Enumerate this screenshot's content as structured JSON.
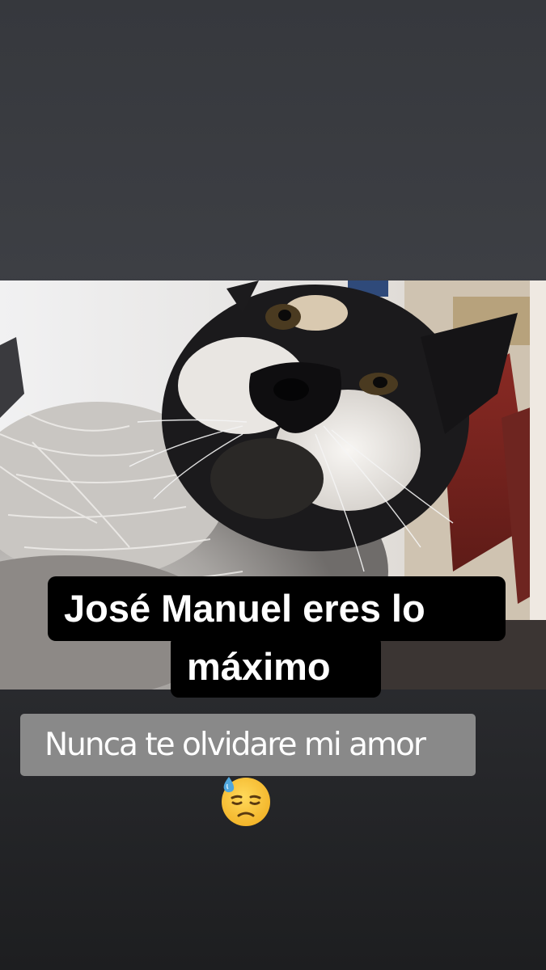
{
  "story": {
    "photo_subject": "cat-photo",
    "caption_line_1": "José Manuel eres lo",
    "caption_line_2": "máximo",
    "subtitle": "Nunca te olvidare mi amor",
    "emoji": "downcast-face-with-sweat-icon"
  },
  "colors": {
    "background_top": "#36383d",
    "background_bottom": "#1d1e20",
    "caption_bg": "#000000",
    "caption_text": "#ffffff",
    "subtitle_bg": "#8e8e8e",
    "emoji_face": "#f6c23a",
    "emoji_sweat": "#4fa6dc"
  }
}
